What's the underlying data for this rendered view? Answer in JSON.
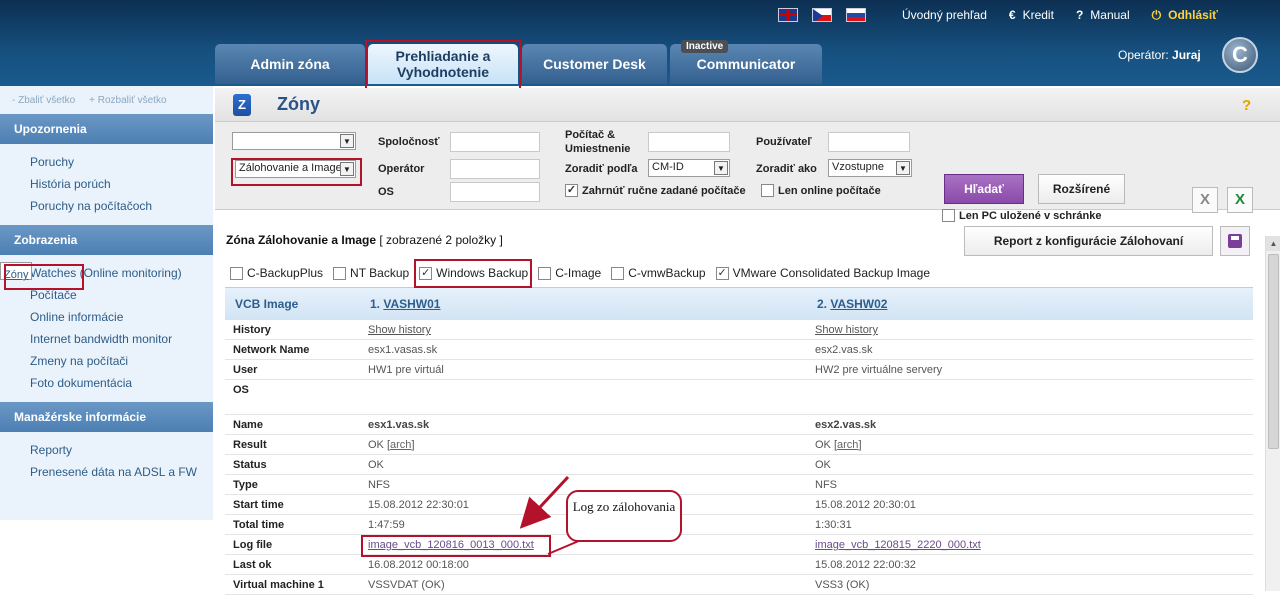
{
  "header": {
    "flags": [
      "en-flag",
      "cz-flag",
      "sk-flag"
    ],
    "links": [
      {
        "label": "Úvodný prehľad",
        "icon": ""
      },
      {
        "label": "Kredit",
        "icon": "€"
      },
      {
        "label": "Manual",
        "icon": "?"
      },
      {
        "label": "Odhlásiť",
        "icon": "⏻"
      }
    ],
    "tabs": [
      {
        "label": "Admin zóna"
      },
      {
        "label": "Prehliadanie a Vyhodnotenie"
      },
      {
        "label": "Customer Desk"
      },
      {
        "label": "Communicator",
        "badge": "Inactive"
      }
    ],
    "operator_label": "Operátor:",
    "operator_name": "Juraj",
    "logo_letter": "C"
  },
  "sidebar": {
    "collapse": "- Zbaliť všetko",
    "expand": "+ Rozbaliť všetko",
    "sections": [
      {
        "title": "Upozornenia",
        "items": [
          "Poruchy",
          "História porúch",
          "Poruchy na počítačoch"
        ]
      },
      {
        "title": "Zobrazenia",
        "items": [
          "Zóny",
          "Watches (Online monitoring)",
          "Počítače",
          "Online informácie",
          "Internet bandwidth monitor",
          "Zmeny na počítači",
          "Foto dokumentácia"
        ]
      },
      {
        "title": "Manažérske informácie",
        "items": [
          "Reporty",
          "Prenesené dáta na ADSL a FW"
        ]
      }
    ]
  },
  "page": {
    "title": "Zóny",
    "help": "?"
  },
  "filter": {
    "select1": "",
    "select2": "Zálohovanie a Image",
    "company_label": "Spoločnosť",
    "operator_label": "Operátor",
    "os_label": "OS",
    "pc_label": "Počítač & Umiestnenie",
    "sort_label": "Zoradiť podľa",
    "sort_value": "CM-ID",
    "include_label": "Zahrnúť ručne zadané počítače",
    "user_label": "Používateľ",
    "order_label": "Zoradiť ako",
    "order_value": "Vzostupne",
    "online_label": "Len online počítače",
    "search_btn": "Hľadať",
    "adv_btn": "Rozšírené",
    "clip_label": "Len PC uložené v schránke"
  },
  "zone": {
    "title": "Zóna Zálohovanie a Image",
    "count": "[ zobrazené 2 položky ]",
    "report_btn": "Report z konfigurácie Zálohovaní",
    "types": [
      {
        "label": "C-BackupPlus",
        "checked": false
      },
      {
        "label": "NT Backup",
        "checked": false
      },
      {
        "label": "Windows Backup",
        "checked": true
      },
      {
        "label": "C-Image",
        "checked": false
      },
      {
        "label": "C-vmwBackup",
        "checked": false
      },
      {
        "label": "VMware Consolidated Backup Image",
        "checked": true
      }
    ],
    "col0": "VCB Image",
    "col1_num": "1.",
    "col1_name": "VASHW01",
    "col2_num": "2.",
    "col2_name": "VASHW02",
    "rows": [
      {
        "k": "History",
        "v1": "Show history",
        "v2": "Show history"
      },
      {
        "k": "Network Name",
        "v1": "esx1.vasas.sk",
        "v2": "esx2.vas.sk"
      },
      {
        "k": "User",
        "v1": "HW1 pre virtuál",
        "v2": "HW2 pre virtuálne servery"
      },
      {
        "k": "OS",
        "v1": "",
        "v2": ""
      },
      {
        "k": "Name",
        "v1": "esx1.vas.sk",
        "v2": "esx2.vas.sk"
      },
      {
        "k": "Result",
        "v1": "OK",
        "v2": "OK",
        "arch": "arch"
      },
      {
        "k": "Status",
        "v1": "OK",
        "v2": "OK"
      },
      {
        "k": "Type",
        "v1": "NFS",
        "v2": "NFS"
      },
      {
        "k": "Start time",
        "v1": "15.08.2012 22:30:01",
        "v2": "15.08.2012 20:30:01"
      },
      {
        "k": "Total time",
        "v1": "1:47:59",
        "v2": "1:30:31"
      },
      {
        "k": "Log file",
        "v1": "image_vcb_120816_0013_000.txt",
        "v2": "image_vcb_120815_2220_000.txt"
      },
      {
        "k": "Last ok",
        "v1": "16.08.2012 00:18:00",
        "v2": "15.08.2012 22:00:32"
      },
      {
        "k": "Virtual machine 1",
        "v1": "VSSVDAT (OK)",
        "v2": "VSS3 (OK)"
      }
    ]
  },
  "callout": "Log zo zálohovania"
}
